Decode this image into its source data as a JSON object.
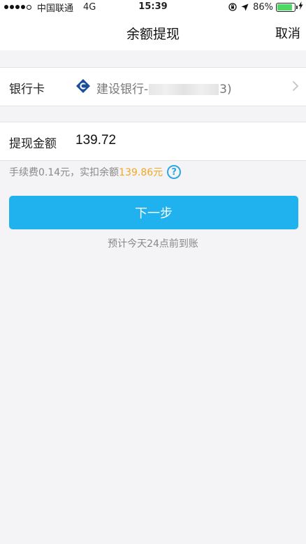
{
  "status_bar": {
    "carrier": "中国联通",
    "network": "4G",
    "time": "15:39",
    "battery_percent": "86%",
    "battery_level": 0.86
  },
  "nav": {
    "title": "余额提现",
    "cancel_label": "取消"
  },
  "bank_card": {
    "label": "银行卡",
    "bank_name_prefix": "建设银行-",
    "bank_name_suffix": "3)",
    "logo_color": "#1a4e9b",
    "icon": "chevron-right-icon"
  },
  "withdraw": {
    "label": "提现金额",
    "amount": "139.72"
  },
  "fee": {
    "prefix": "手续费0.14元，实扣余额",
    "deduct_amount": "139.86元",
    "help_symbol": "?",
    "highlight_color": "#f5a623"
  },
  "actions": {
    "next_label": "下一步",
    "button_color": "#20b2ee"
  },
  "arrival_note": "预计今天24点前到账"
}
